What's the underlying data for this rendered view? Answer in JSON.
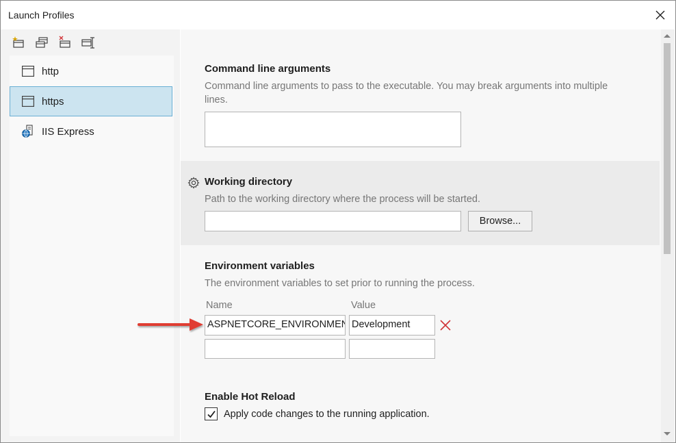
{
  "window": {
    "title": "Launch Profiles"
  },
  "toolbar": {
    "buttons": [
      {
        "icon": "new-profile-icon"
      },
      {
        "icon": "copy-profile-icon"
      },
      {
        "icon": "delete-profile-icon"
      },
      {
        "icon": "rename-profile-icon"
      }
    ]
  },
  "profiles": [
    {
      "label": "http",
      "icon": "window-icon",
      "selected": false
    },
    {
      "label": "https",
      "icon": "window-icon",
      "selected": true
    },
    {
      "label": "IIS Express",
      "icon": "globe-server-icon",
      "selected": false
    }
  ],
  "command_line": {
    "title": "Command line arguments",
    "description": "Command line arguments to pass to the executable. You may break arguments into multiple lines.",
    "value": ""
  },
  "working_directory": {
    "title": "Working directory",
    "description": "Path to the working directory where the process will be started.",
    "value": "",
    "browse_label": "Browse..."
  },
  "environment": {
    "title": "Environment variables",
    "description": "The environment variables to set prior to running the process.",
    "name_header": "Name",
    "value_header": "Value",
    "rows": [
      {
        "name": "ASPNETCORE_ENVIRONMENT",
        "value": "Development"
      },
      {
        "name": "",
        "value": ""
      }
    ]
  },
  "hot_reload": {
    "title": "Enable Hot Reload",
    "checkbox_label": "Apply code changes to the running application.",
    "checked": true
  },
  "colors": {
    "selection": "#cce4f0",
    "selection_border": "#69afd4",
    "delete_x": "#d13438",
    "arrow": "#e03c31"
  }
}
